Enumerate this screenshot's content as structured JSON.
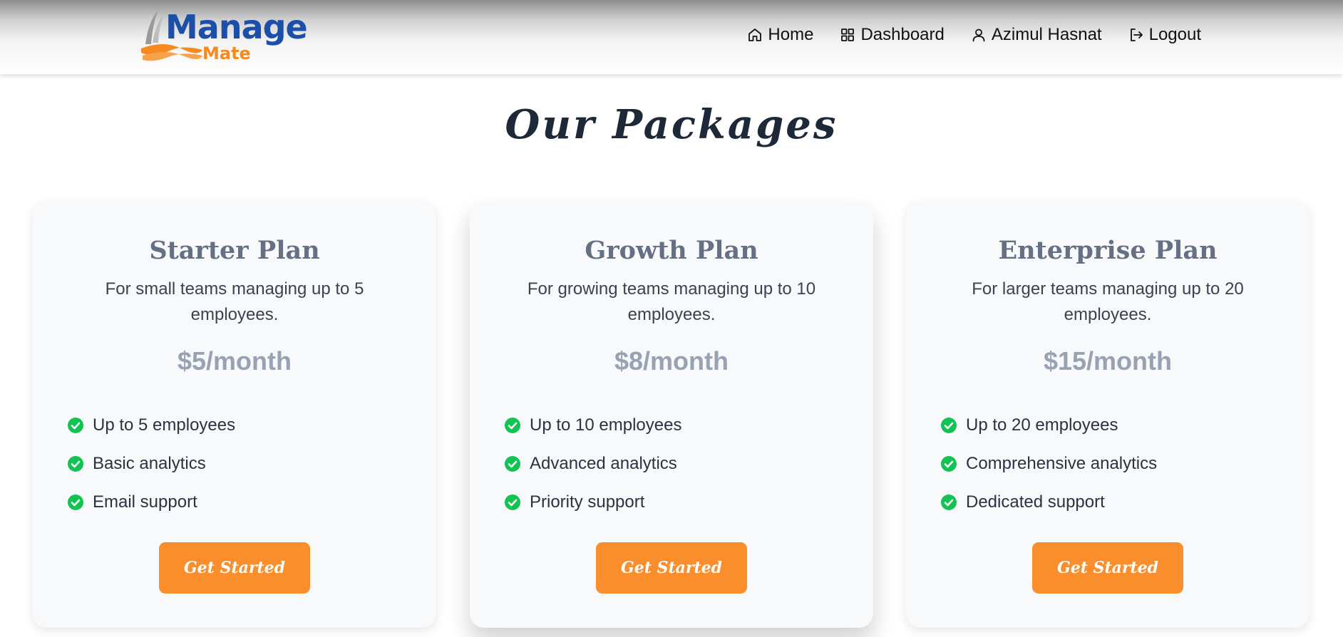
{
  "logo": {
    "word_top": "Manage",
    "word_bottom": "Mate",
    "colors": {
      "primary": "#1b4fa8",
      "accent": "#f58a20",
      "wing": "#9a9a9a"
    }
  },
  "nav": {
    "items": [
      {
        "label": "Home",
        "icon": "home-icon"
      },
      {
        "label": "Dashboard",
        "icon": "grid-icon"
      },
      {
        "label": "Azimul Hasnat",
        "icon": "user-icon"
      },
      {
        "label": "Logout",
        "icon": "logout-icon"
      }
    ]
  },
  "page": {
    "title": "Our Packages"
  },
  "plans": [
    {
      "name": "Starter Plan",
      "description": "For small teams managing up to 5 employees.",
      "price": "$5/month",
      "features": [
        "Up to 5 employees",
        "Basic analytics",
        "Email support"
      ],
      "cta": "Get Started"
    },
    {
      "name": "Growth Plan",
      "description": "For growing teams managing up to 10 employees.",
      "price": "$8/month",
      "features": [
        "Up to 10 employees",
        "Advanced analytics",
        "Priority support"
      ],
      "cta": "Get Started"
    },
    {
      "name": "Enterprise Plan",
      "description": "For larger teams managing up to 20 employees.",
      "price": "$15/month",
      "features": [
        "Up to 20 employees",
        "Comprehensive analytics",
        "Dedicated support"
      ],
      "cta": "Get Started"
    }
  ],
  "colors": {
    "title": "#1d2939",
    "card_bg": "#f8f9fb",
    "plan_name": "#667085",
    "price": "#98a2b3",
    "check": "#12c353",
    "button": "#fb8e2c",
    "button_text": "#ffffff"
  },
  "icons": {
    "feature": "check-circle-icon"
  }
}
